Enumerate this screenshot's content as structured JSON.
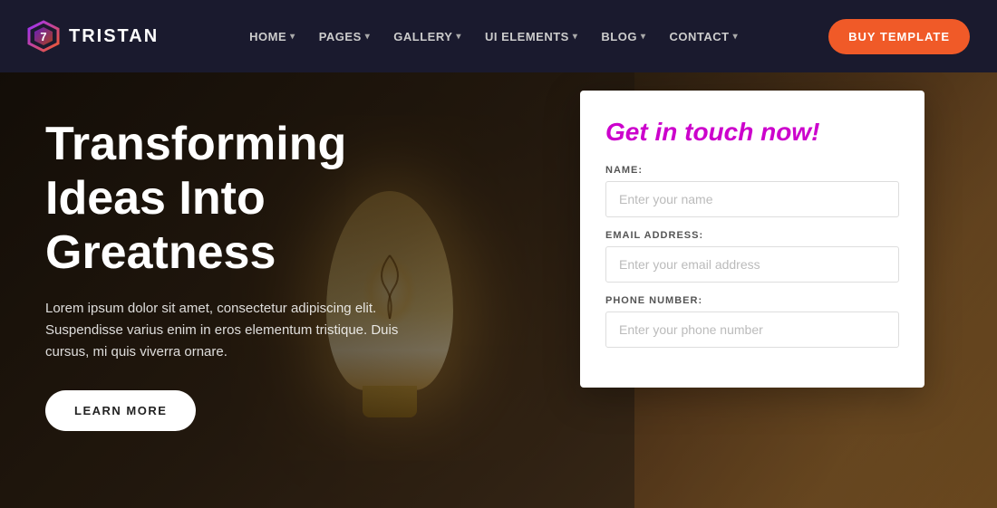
{
  "brand": {
    "logo_text": "TRISTAN"
  },
  "navbar": {
    "links": [
      {
        "label": "HOME",
        "has_dropdown": true
      },
      {
        "label": "PAGES",
        "has_dropdown": true
      },
      {
        "label": "GALLERY",
        "has_dropdown": true
      },
      {
        "label": "UI ELEMENTS",
        "has_dropdown": true
      },
      {
        "label": "BLOG",
        "has_dropdown": true
      },
      {
        "label": "CONTACT",
        "has_dropdown": true
      }
    ],
    "cta_label": "BUY TEMPLATE"
  },
  "hero": {
    "title": "Transforming Ideas Into Greatness",
    "subtitle": "Lorem ipsum dolor sit amet, consectetur adipiscing elit. Suspendisse varius enim in eros elementum tristique. Duis cursus, mi quis viverra ornare.",
    "cta_label": "LEARN MORE"
  },
  "contact_form": {
    "title": "Get in touch now!",
    "fields": [
      {
        "id": "name",
        "label": "NAME:",
        "placeholder": "Enter your name"
      },
      {
        "id": "email",
        "label": "EMAIL ADDRESS:",
        "placeholder": "Enter your email address"
      },
      {
        "id": "phone",
        "label": "PHONE NUMBER:",
        "placeholder": "Enter your phone number"
      }
    ]
  },
  "colors": {
    "navbar_bg": "#1a1a2e",
    "cta_bg": "#f05a28",
    "contact_title": "#cc00cc",
    "accent": "#cc00cc"
  }
}
